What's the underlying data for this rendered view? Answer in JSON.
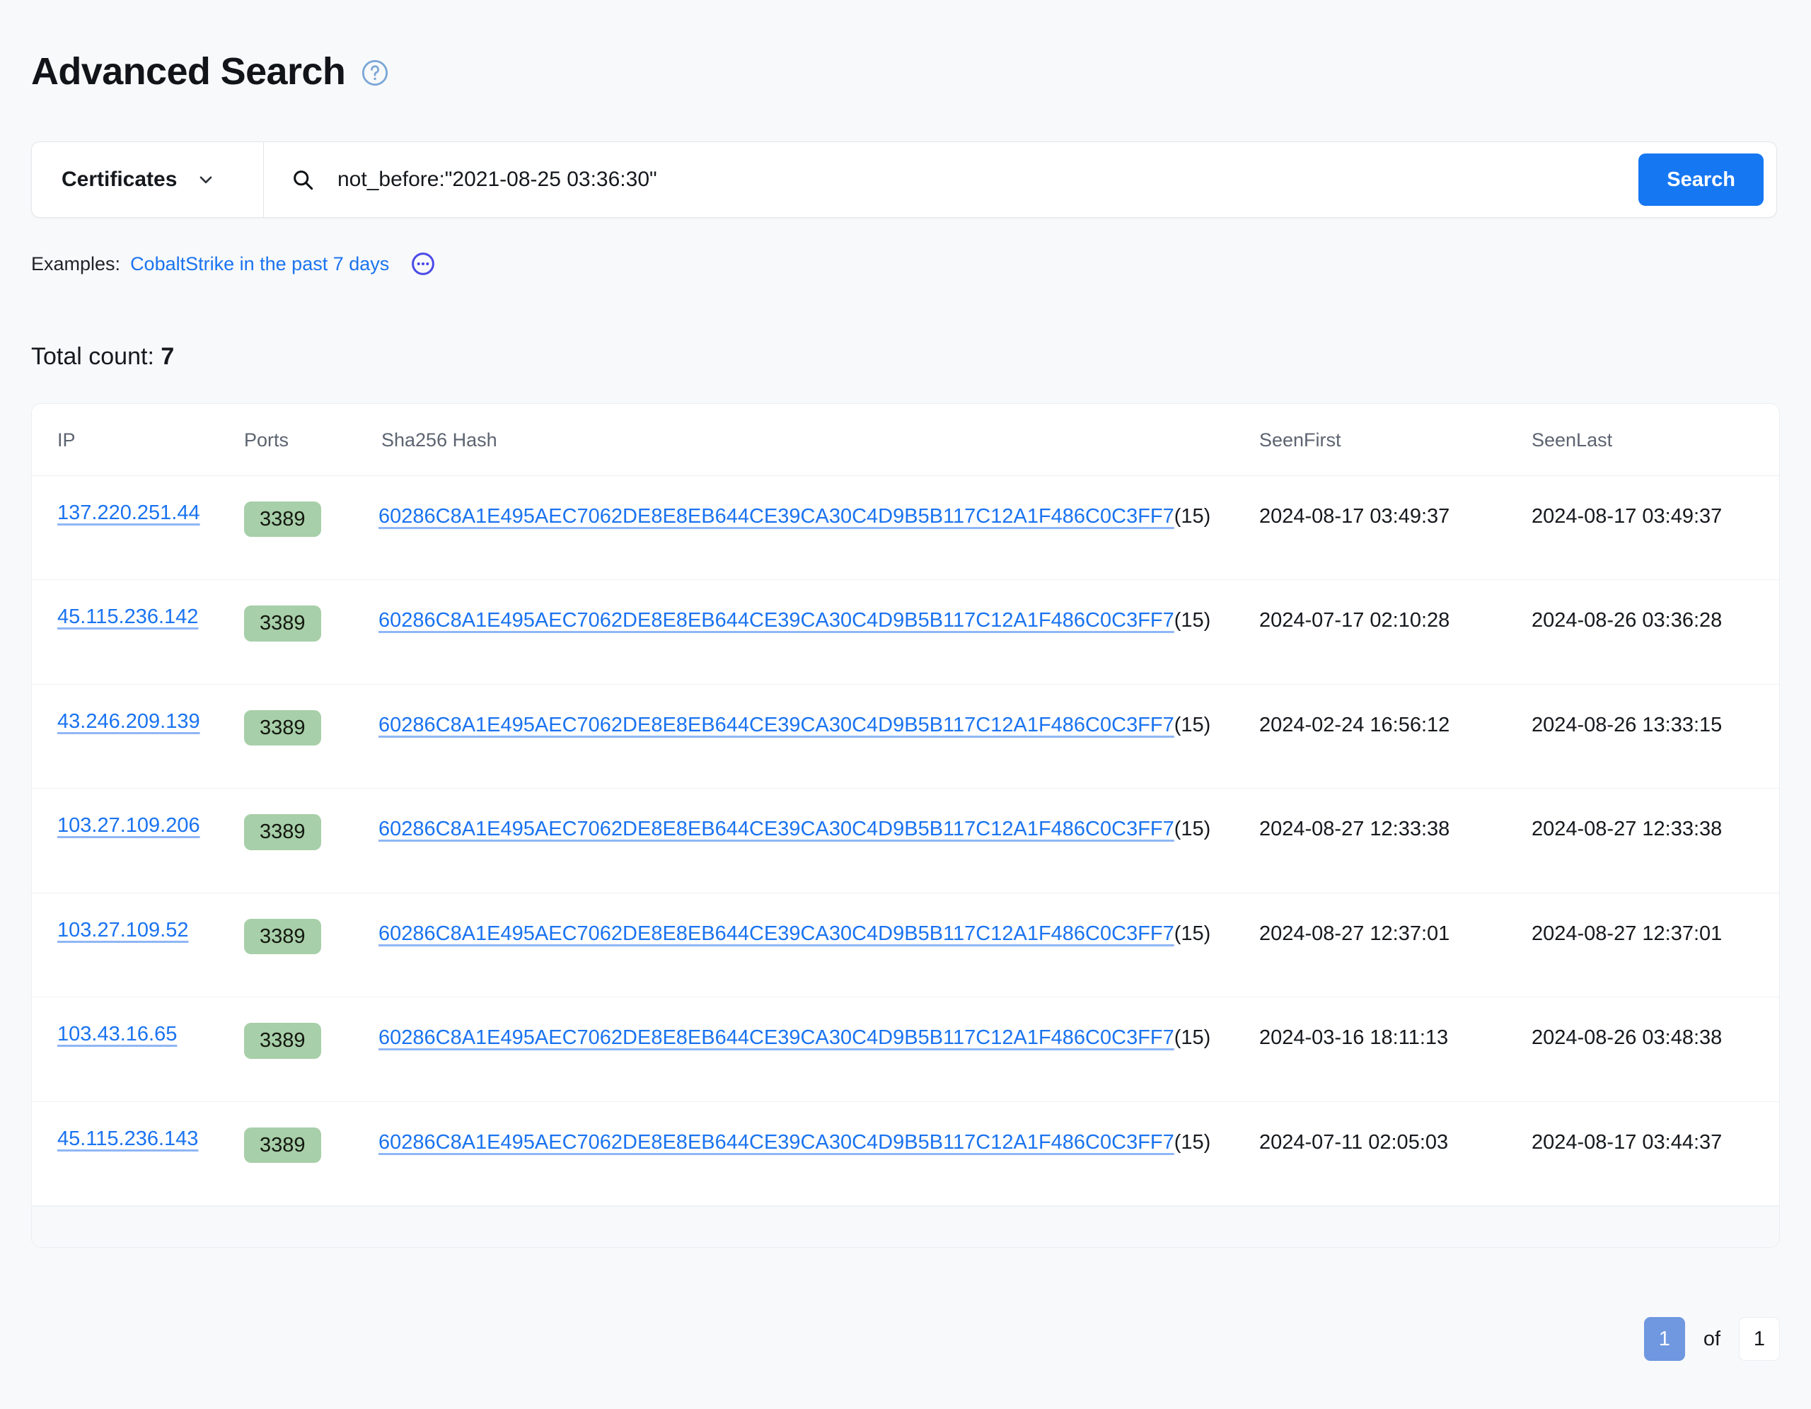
{
  "header": {
    "title": "Advanced Search",
    "help_icon": "help-circle-icon",
    "help_icon_color": "#7ba7d7"
  },
  "search": {
    "scope_selected": "Certificates",
    "scope_icon": "chevron-down-icon",
    "search_icon": "search-icon",
    "query_value": "not_before:\"2021-08-25 03:36:30\"",
    "query_placeholder": "Search",
    "submit_label": "Search",
    "submit_color": "#1677f2"
  },
  "examples": {
    "label": "Examples:",
    "link_text": "CobaltStrike in the past 7 days",
    "more_icon": "ellipsis-circle-icon",
    "more_icon_color": "#4a4ae8",
    "link_color": "#1a73f0"
  },
  "results": {
    "total_count_label": "Total count:",
    "total_count_value": "7",
    "columns": [
      "IP",
      "Ports",
      "Sha256 Hash",
      "SeenFirst",
      "SeenLast"
    ],
    "badge_color": "#a7cfa9",
    "rows": [
      {
        "ip": "137.220.251.44",
        "ports": [
          "3389"
        ],
        "hash": "60286C8A1E495AEC7062DE8E8EB644CE39CA30C4D9B5B117C12A1F486C0C3FF7",
        "hash_count": "(15)",
        "seen_first": "2024-08-17 03:49:37",
        "seen_last": "2024-08-17 03:49:37"
      },
      {
        "ip": "45.115.236.142",
        "ports": [
          "3389"
        ],
        "hash": "60286C8A1E495AEC7062DE8E8EB644CE39CA30C4D9B5B117C12A1F486C0C3FF7",
        "hash_count": "(15)",
        "seen_first": "2024-07-17 02:10:28",
        "seen_last": "2024-08-26 03:36:28"
      },
      {
        "ip": "43.246.209.139",
        "ports": [
          "3389"
        ],
        "hash": "60286C8A1E495AEC7062DE8E8EB644CE39CA30C4D9B5B117C12A1F486C0C3FF7",
        "hash_count": "(15)",
        "seen_first": "2024-02-24 16:56:12",
        "seen_last": "2024-08-26 13:33:15"
      },
      {
        "ip": "103.27.109.206",
        "ports": [
          "3389"
        ],
        "hash": "60286C8A1E495AEC7062DE8E8EB644CE39CA30C4D9B5B117C12A1F486C0C3FF7",
        "hash_count": "(15)",
        "seen_first": "2024-08-27 12:33:38",
        "seen_last": "2024-08-27 12:33:38"
      },
      {
        "ip": "103.27.109.52",
        "ports": [
          "3389"
        ],
        "hash": "60286C8A1E495AEC7062DE8E8EB644CE39CA30C4D9B5B117C12A1F486C0C3FF7",
        "hash_count": "(15)",
        "seen_first": "2024-08-27 12:37:01",
        "seen_last": "2024-08-27 12:37:01"
      },
      {
        "ip": "103.43.16.65",
        "ports": [
          "3389"
        ],
        "hash": "60286C8A1E495AEC7062DE8E8EB644CE39CA30C4D9B5B117C12A1F486C0C3FF7",
        "hash_count": "(15)",
        "seen_first": "2024-03-16 18:11:13",
        "seen_last": "2024-08-26 03:48:38"
      },
      {
        "ip": "45.115.236.143",
        "ports": [
          "3389"
        ],
        "hash": "60286C8A1E495AEC7062DE8E8EB644CE39CA30C4D9B5B117C12A1F486C0C3FF7",
        "hash_count": "(15)",
        "seen_first": "2024-07-11 02:05:03",
        "seen_last": "2024-08-17 03:44:37"
      }
    ]
  },
  "pagination": {
    "current_page": "1",
    "of_label": "of",
    "total_pages": "1",
    "current_color": "#6f98e0"
  }
}
